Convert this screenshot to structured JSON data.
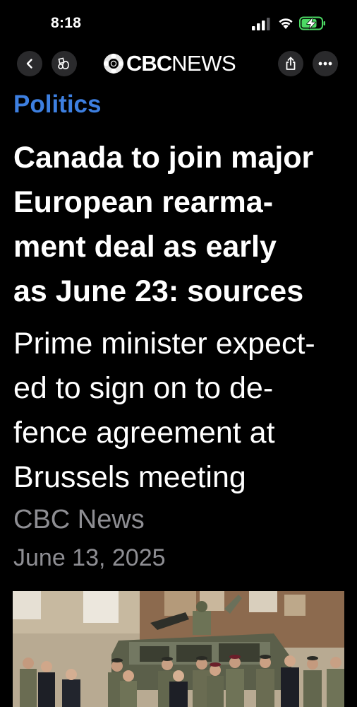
{
  "status_bar": {
    "time": "8:18"
  },
  "nav": {
    "brand_cbc": "CBC",
    "brand_news": "NEWS"
  },
  "article": {
    "section": "Politics",
    "headline_lines": [
      "Canada to join major",
      "European rearma-",
      "ment deal as early",
      "as June 23: sources"
    ],
    "subhead_lines": [
      "Prime minister expect-",
      "ed to sign on to de-",
      "fence agreement at",
      "Brussels meeting"
    ],
    "source": "CBC News",
    "date": "June 13, 2025"
  },
  "colors": {
    "background": "#000000",
    "section_accent": "#3d7fe0",
    "meta_gray": "#8e8e93",
    "button_bg": "#2a2a2c",
    "battery_charge": "#4cd964"
  },
  "icons": [
    "signal-icon",
    "wifi-icon",
    "battery-charging-icon",
    "back-chevron-icon",
    "reader-mode-icon",
    "cbc-gem-logo",
    "share-icon",
    "more-icon"
  ]
}
